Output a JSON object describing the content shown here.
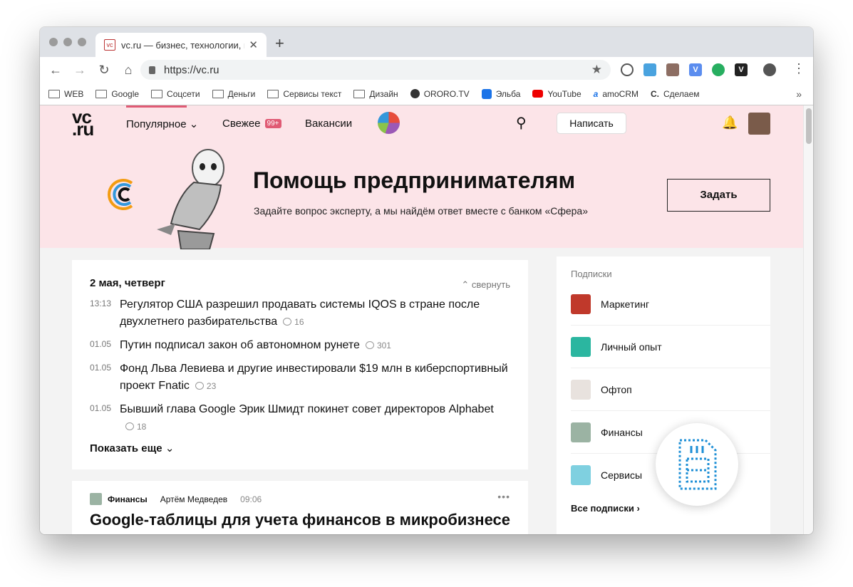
{
  "browser": {
    "tab_title": "vc.ru — бизнес, технологии, и",
    "favicon": "vc",
    "close": "✕",
    "new_tab": "+",
    "url": "https://vc.ru",
    "star": "★",
    "menu": "⋮"
  },
  "bookmarks": [
    {
      "label": "WEB",
      "icon": "folder-icon"
    },
    {
      "label": "Google",
      "icon": "folder-icon"
    },
    {
      "label": "Соцсети",
      "icon": "folder-icon"
    },
    {
      "label": "Деньги",
      "icon": "folder-icon"
    },
    {
      "label": "Сервисы текст",
      "icon": "folder-icon"
    },
    {
      "label": "Дизайн",
      "icon": "folder-icon"
    },
    {
      "label": "ORORO.TV",
      "icon": "ororo-icon"
    },
    {
      "label": "Эльба",
      "icon": "elba-icon"
    },
    {
      "label": "YouTube",
      "icon": "youtube-icon"
    },
    {
      "label": "amoCRM",
      "icon": "amocrm-icon"
    },
    {
      "label": "Сделаем",
      "icon": "sdelaem-icon"
    }
  ],
  "bookmarks_more": "»",
  "site": {
    "logo_top": "vc",
    "logo_bottom": ".ru",
    "nav_popular": "Популярное",
    "nav_popular_caret": "⌄",
    "nav_fresh": "Свежее",
    "nav_fresh_badge": "99+",
    "nav_jobs": "Вакансии",
    "write_button": "Написать",
    "search_icon": "⌕",
    "bell_icon": "♫"
  },
  "promo": {
    "title": "Помощь предпринимателям",
    "subtitle": "Задайте вопрос эксперту, а мы найдём ответ вместе с банком «Сфера»",
    "button": "Задать"
  },
  "feed": {
    "date": "2 мая, четверг",
    "collapse": "свернуть",
    "items": [
      {
        "time": "13:13",
        "text": "Регулятор США разрешил продавать системы IQOS в стране после двухлетнего разбирательства",
        "comments": "16"
      },
      {
        "time": "01.05",
        "text": "Путин подписал закон об автономном рунете",
        "comments": "301"
      },
      {
        "time": "01.05",
        "text": "Фонд Льва Левиева и другие инвестировали $19 млн в киберспортивный проект Fnatic",
        "comments": "23"
      },
      {
        "time": "01.05",
        "text": "Бывший глава Google Эрик Шмидт покинет совет директоров Alphabet",
        "comments": "18"
      }
    ],
    "show_more": "Показать еще"
  },
  "article": {
    "category": "Финансы",
    "author": "Артём Медведев",
    "time": "09:06",
    "title": "Google-таблицы для учета финансов в микробизнесе",
    "menu": "•••"
  },
  "subscriptions": {
    "heading": "Подписки",
    "items": [
      {
        "name": "Маркетинг",
        "color": "#c0392b"
      },
      {
        "name": "Личный опыт",
        "color": "#2bb6a0"
      },
      {
        "name": "Офтоп",
        "color": "#e8e2de"
      },
      {
        "name": "Финансы",
        "color": "#9bb3a3"
      },
      {
        "name": "Сервисы",
        "color": "#7fd0e0"
      }
    ],
    "all": "Все подписки"
  }
}
